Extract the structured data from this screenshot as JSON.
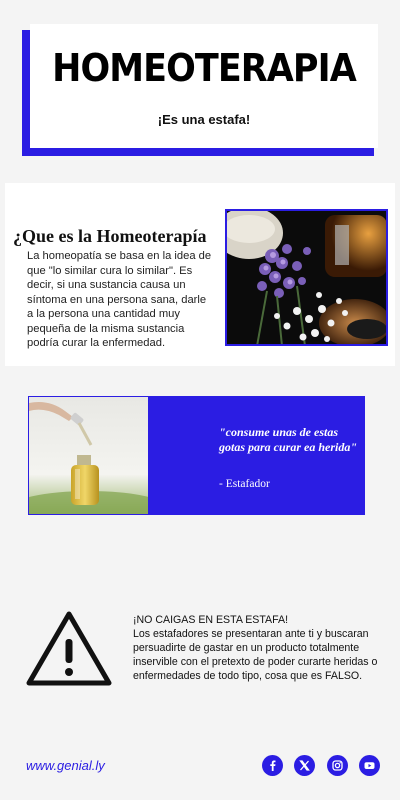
{
  "header": {
    "title": "HOMEOTERAPIA",
    "subtitle": "¡Es una estafa!"
  },
  "what_is": {
    "title": "¿Que es la Homeoterapía",
    "body": "La homeopatía se basa en la idea de que \"lo similar cura lo similar\". Es decir, si una sustancia causa un síntoma en una persona sana, darle a la persona una cantidad muy pequeña de la misma sustancia podría curar la enfermedad.",
    "image_icon": "homeopathy-flowers-bottles-image"
  },
  "quote": {
    "text": "\"consume unas de estas gotas  para curar ea herida\"",
    "author": "- Estafador",
    "image_icon": "dropper-bottle-image"
  },
  "warning": {
    "icon": "warning-triangle-icon",
    "heading": "¡NO CAIGAS EN ESTA ESTAFA!",
    "body": "Los estafadores se presentaran ante ti y buscaran persuadirte de gastar en un producto totalmente inservible con el pretexto de poder curarte heridas o enfermedades de todo tipo, cosa que es FALSO."
  },
  "footer": {
    "url": "www.genial.ly",
    "social_icons": [
      "facebook-icon",
      "x-icon",
      "instagram-icon",
      "youtube-icon"
    ]
  },
  "colors": {
    "accent": "#2b1de3",
    "background": "#f4f4f4"
  }
}
